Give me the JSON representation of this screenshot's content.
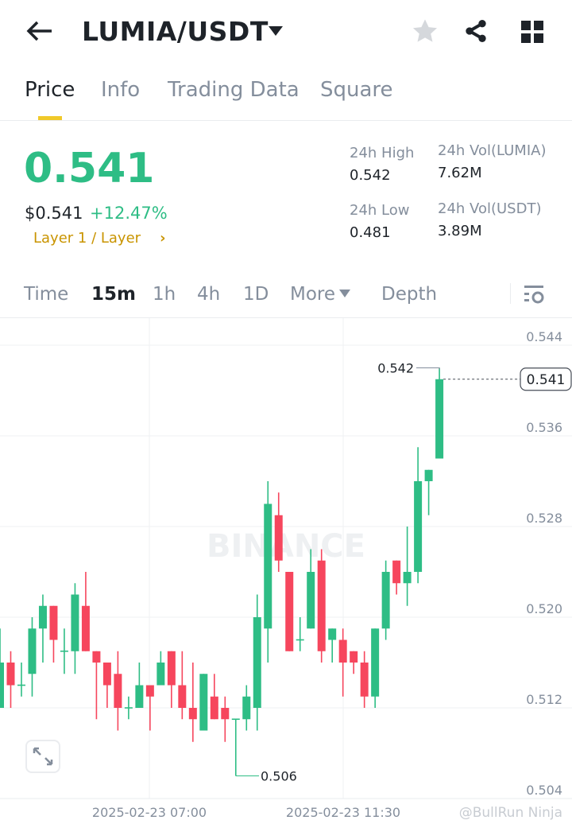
{
  "header": {
    "title": "LUMIA/USDT"
  },
  "tabs": [
    {
      "label": "Price"
    },
    {
      "label": "Info"
    },
    {
      "label": "Trading Data"
    },
    {
      "label": "Square"
    }
  ],
  "ticker": {
    "price": "0.541",
    "usd_price": "$0.541",
    "change": "+12.47%",
    "category": "Layer 1 / Layer"
  },
  "stats": {
    "high_label": "24h High",
    "high": "0.542",
    "low_label": "24h Low",
    "low": "0.481",
    "vol_base_label": "24h Vol(LUMIA)",
    "vol_base": "7.62M",
    "vol_quote_label": "24h Vol(USDT)",
    "vol_quote": "3.89M"
  },
  "timeframes": [
    {
      "label": "Time"
    },
    {
      "label": "15m"
    },
    {
      "label": "1h"
    },
    {
      "label": "4h"
    },
    {
      "label": "1D"
    },
    {
      "label": "More"
    },
    {
      "label": "Depth"
    }
  ],
  "colors": {
    "up": "#2ebd85",
    "down": "#f6465d",
    "accent": "#f0c929"
  },
  "watermark": "BINANCE",
  "credit": "@BullRun Ninja",
  "chart_data": {
    "type": "candlestick",
    "interval": "15m",
    "ylim": [
      0.504,
      0.544
    ],
    "yticks": [
      "0.544",
      "0.536",
      "0.528",
      "0.520",
      "0.512",
      "0.504"
    ],
    "xticks": [
      "2025-02-23 07:00",
      "2025-02-23 11:30"
    ],
    "last_price_label": "0.541",
    "high_marker": "0.542",
    "low_marker": "0.506",
    "candles": [
      [
        0.512,
        0.519,
        0.512,
        0.516
      ],
      [
        0.516,
        0.517,
        0.512,
        0.514
      ],
      [
        0.514,
        0.516,
        0.513,
        0.514
      ],
      [
        0.515,
        0.52,
        0.513,
        0.519
      ],
      [
        0.519,
        0.522,
        0.516,
        0.521
      ],
      [
        0.521,
        0.521,
        0.516,
        0.518
      ],
      [
        0.517,
        0.519,
        0.515,
        0.517
      ],
      [
        0.517,
        0.523,
        0.515,
        0.522
      ],
      [
        0.521,
        0.524,
        0.517,
        0.517
      ],
      [
        0.517,
        0.517,
        0.511,
        0.516
      ],
      [
        0.516,
        0.516,
        0.512,
        0.514
      ],
      [
        0.515,
        0.517,
        0.51,
        0.512
      ],
      [
        0.512,
        0.513,
        0.511,
        0.512
      ],
      [
        0.512,
        0.516,
        0.512,
        0.514
      ],
      [
        0.514,
        0.514,
        0.51,
        0.513
      ],
      [
        0.514,
        0.517,
        0.514,
        0.516
      ],
      [
        0.517,
        0.517,
        0.512,
        0.514
      ],
      [
        0.514,
        0.517,
        0.511,
        0.512
      ],
      [
        0.512,
        0.516,
        0.509,
        0.511
      ],
      [
        0.51,
        0.515,
        0.51,
        0.515
      ],
      [
        0.513,
        0.515,
        0.511,
        0.511
      ],
      [
        0.512,
        0.513,
        0.509,
        0.511
      ],
      [
        0.511,
        0.511,
        0.506,
        0.511
      ],
      [
        0.511,
        0.514,
        0.51,
        0.513
      ],
      [
        0.512,
        0.522,
        0.51,
        0.52
      ],
      [
        0.519,
        0.532,
        0.516,
        0.53
      ],
      [
        0.529,
        0.531,
        0.524,
        0.525
      ],
      [
        0.524,
        0.524,
        0.517,
        0.517
      ],
      [
        0.518,
        0.52,
        0.517,
        0.518
      ],
      [
        0.519,
        0.526,
        0.519,
        0.524
      ],
      [
        0.525,
        0.526,
        0.516,
        0.517
      ],
      [
        0.518,
        0.519,
        0.516,
        0.519
      ],
      [
        0.518,
        0.519,
        0.513,
        0.516
      ],
      [
        0.517,
        0.517,
        0.515,
        0.516
      ],
      [
        0.516,
        0.517,
        0.512,
        0.513
      ],
      [
        0.513,
        0.519,
        0.512,
        0.519
      ],
      [
        0.519,
        0.525,
        0.518,
        0.524
      ],
      [
        0.525,
        0.525,
        0.522,
        0.523
      ],
      [
        0.523,
        0.528,
        0.521,
        0.524
      ],
      [
        0.524,
        0.535,
        0.523,
        0.532
      ],
      [
        0.532,
        0.533,
        0.529,
        0.533
      ],
      [
        0.534,
        0.542,
        0.534,
        0.541
      ]
    ]
  }
}
